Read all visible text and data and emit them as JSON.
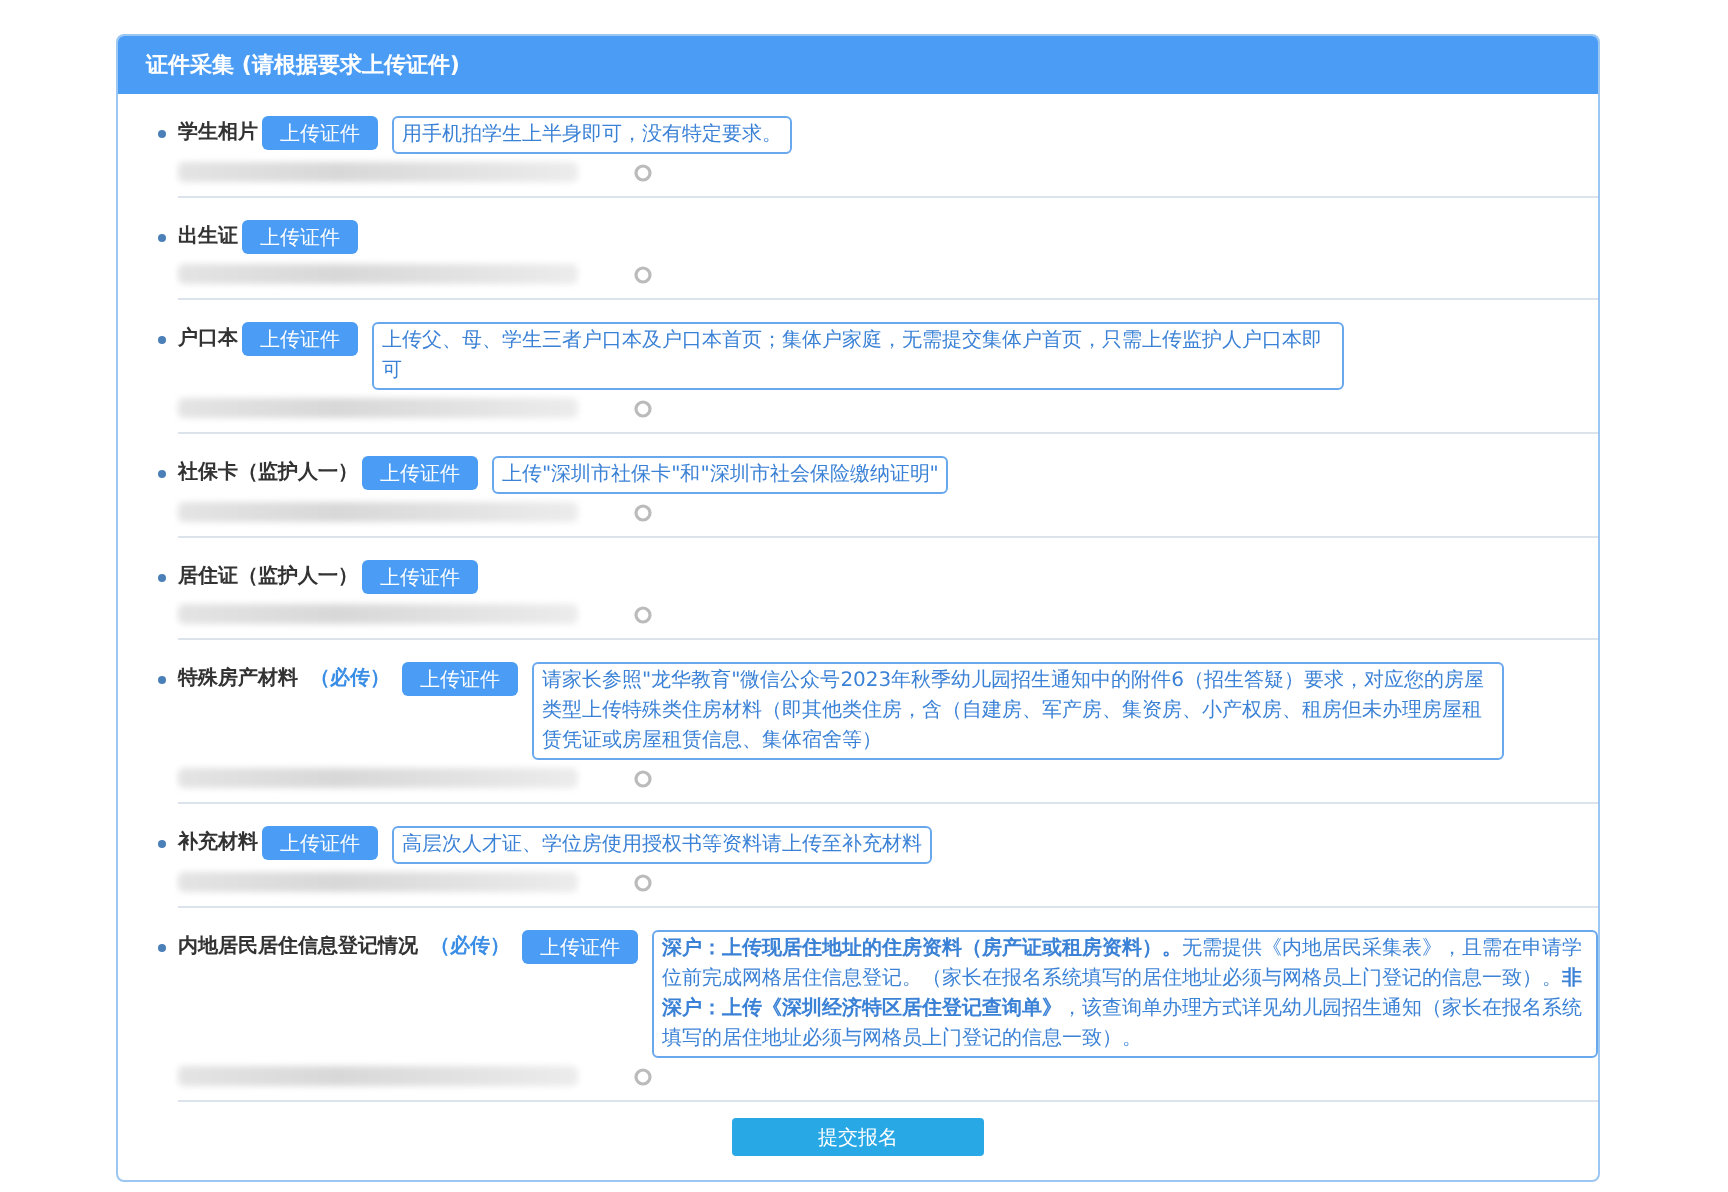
{
  "panel": {
    "title": "证件采集 (请根据要求上传证件)"
  },
  "items": [
    {
      "label": "学生相片",
      "button": "上传证件",
      "hint": "用手机拍学生上半身即可，没有特定要求。"
    },
    {
      "label": "出生证",
      "button": "上传证件"
    },
    {
      "label": "户口本",
      "button": "上传证件",
      "hint": "上传父、母、学生三者户口本及户口本首页；集体户家庭，无需提交集体户首页，只需上传监护人户口本即可"
    },
    {
      "label": "社保卡（监护人一）",
      "button": "上传证件",
      "hint": "上传\"深圳市社保卡\"和\"深圳市社会保险缴纳证明\""
    },
    {
      "label": "居住证（监护人一）",
      "button": "上传证件"
    },
    {
      "label": "特殊房产材料",
      "required_tag": "（必传）",
      "button": "上传证件",
      "hint": "请家长参照\"龙华教育\"微信公众号2023年秋季幼儿园招生通知中的附件6（招生答疑）要求，对应您的房屋类型上传特殊类住房材料（即其他类住房，含（自建房、军产房、集资房、小产权房、租房但未办理房屋租赁凭证或房屋租赁信息、集体宿舍等）"
    },
    {
      "label": "补充材料",
      "button": "上传证件",
      "hint": "高层次人才证、学位房使用授权书等资料请上传至补充材料"
    },
    {
      "label": "内地居民居住信息登记情况",
      "required_tag": "（必传）",
      "button": "上传证件",
      "hint": "**深户：上传现居住地址的住房资料（房产证或租房资料）。**无需提供《内地居民采集表》，且需在申请学位前完成网格居住信息登记。（家长在报名系统填写的居住地址必须与网格员上门登记的信息一致）。**非深户：上传《深圳经济特区居住登记查询单》**，该查询单办理方式详见幼儿园招生通知（家长在报名系统填写的居住地址必须与网格员上门登记的信息一致）。"
    }
  ],
  "submit": "提交报名"
}
